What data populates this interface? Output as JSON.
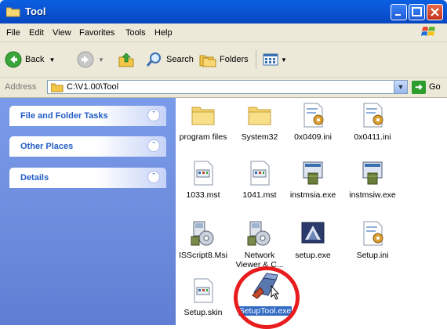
{
  "window": {
    "title": "Tool"
  },
  "menu": [
    "File",
    "Edit",
    "View",
    "Favorites",
    "Tools",
    "Help"
  ],
  "toolbar": {
    "back_label": "Back",
    "search_label": "Search",
    "folders_label": "Folders"
  },
  "address": {
    "label": "Address",
    "path": "C:\\V1.00\\Tool",
    "go_label": "Go"
  },
  "tasks": [
    "File and Folder Tasks",
    "Other Places",
    "Details"
  ],
  "files": [
    {
      "name": "program files",
      "icon": "folder-icon"
    },
    {
      "name": "System32",
      "icon": "folder-icon"
    },
    {
      "name": "0x0409.ini",
      "icon": "ini-file-icon"
    },
    {
      "name": "0x0411.ini",
      "icon": "ini-file-icon"
    },
    {
      "name": "1033.mst",
      "icon": "mst-file-icon"
    },
    {
      "name": "1041.mst",
      "icon": "mst-file-icon"
    },
    {
      "name": "instmsia.exe",
      "icon": "installer-exe-icon"
    },
    {
      "name": "instmsiw.exe",
      "icon": "installer-exe-icon"
    },
    {
      "name": "ISScript8.Msi",
      "icon": "msi-package-icon"
    },
    {
      "name": "Network Viewer & C...",
      "icon": "msi-package-icon"
    },
    {
      "name": "setup.exe",
      "icon": "setup-exe-icon"
    },
    {
      "name": "Setup.ini",
      "icon": "ini-file-icon"
    },
    {
      "name": "Setup.skin",
      "icon": "skin-file-icon"
    },
    {
      "name": "SetupTool.exe",
      "icon": "setuptool-exe-icon",
      "selected": true
    }
  ],
  "colors": {
    "titlebar": "#0b56d6",
    "sidepanel": "#7a9bea",
    "highlight": "#e81c1c",
    "selection": "#316ac5"
  }
}
